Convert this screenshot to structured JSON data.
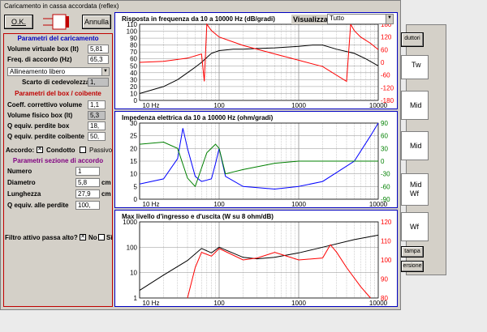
{
  "window": {
    "title": "Caricamento in cassa accordata (reflex)"
  },
  "toolbar": {
    "ok": "O.K.",
    "annulla": "Annulla"
  },
  "visualizza": {
    "label": "Visualizza",
    "value": "Tutto"
  },
  "params": {
    "title": "Parametri del caricamento",
    "vol_label": "Volume virtuale box (lt)",
    "vol": "5,81",
    "freq_label": "Freq. di accordo (Hz)",
    "freq": "65,3",
    "allineamento": "Allineamento libero",
    "scarto_label": "Scarto di cedevolezza",
    "scarto": "1,"
  },
  "box": {
    "title": "Parametri del box / coibente",
    "coeff_label": "Coeff. correttivo volume",
    "coeff": "1,1",
    "volfis_label": "Volume fisico box (lt)",
    "volfis": "5,3",
    "qbox_label": "Q equiv. perdite box",
    "qbox": "18,",
    "qcoib_label": "Q equiv. perdite coibente",
    "qcoib": "50,"
  },
  "accordo": {
    "label": "Accordo:",
    "condotto": "Condotto",
    "passivo": "Passivo"
  },
  "sezione": {
    "title": "Parametri sezione di accordo",
    "numero_label": "Numero",
    "numero": "1",
    "diametro_label": "Diametro",
    "diametro": "5,8",
    "diametro_unit": "cm",
    "lunghezza_label": "Lunghezza",
    "lunghezza": "27,9",
    "lunghezza_unit": "cm",
    "qperd_label": "Q equiv. alle perdite",
    "qperd": "100,"
  },
  "filtro": {
    "label": "Filtro attivo passa alto?",
    "no": "No",
    "si": "Sì"
  },
  "right": {
    "tab": "duttori",
    "tw": "Tw",
    "mid1": "Mid",
    "mid2": "Mid",
    "midwf1": "Mid",
    "midwf2": "Wf",
    "wf": "Wf",
    "stampa": "tampa",
    "versione": "ersione"
  },
  "chart_data": [
    {
      "type": "line",
      "title": "Risposta in frequenza da 10 a 10000 Hz (dB/gradi)",
      "xscale": "log",
      "xlim": [
        10,
        10000
      ],
      "ylim": [
        0,
        110
      ],
      "y2lim": [
        -180,
        180
      ],
      "yticks": [
        "110",
        "100",
        "90",
        "80",
        "70",
        "60",
        "50",
        "40",
        "30",
        "20",
        "10",
        "0"
      ],
      "y2ticks": [
        "180",
        "120",
        "60",
        "0",
        "-60",
        "-120",
        "-180"
      ],
      "xticks": [
        "10 Hz",
        "100",
        "1000",
        "10000"
      ],
      "series": [
        {
          "color": "#000000",
          "axis": "left",
          "x": [
            10,
            20,
            30,
            40,
            50,
            60,
            70,
            80,
            100,
            150,
            200,
            300,
            500,
            1000,
            1500,
            2000,
            3000,
            5000,
            7000,
            10000
          ],
          "y": [
            10,
            20,
            30,
            40,
            48,
            55,
            62,
            68,
            72,
            74,
            74,
            75,
            76,
            78,
            80,
            80,
            74,
            68,
            60,
            50
          ]
        },
        {
          "color": "#ff0000",
          "axis": "right",
          "x": [
            10,
            20,
            40,
            60,
            65,
            70,
            80,
            100,
            200,
            500,
            1000,
            2000,
            4000,
            4500,
            5000,
            6000,
            8000,
            10000
          ],
          "y": [
            0,
            5,
            20,
            40,
            -90,
            180,
            150,
            120,
            80,
            40,
            10,
            -20,
            -90,
            180,
            150,
            120,
            90,
            60
          ]
        }
      ]
    },
    {
      "type": "line",
      "title": "Impedenza elettrica da 10 a 10000 Hz (ohm/gradi)",
      "xscale": "log",
      "xlim": [
        10,
        10000
      ],
      "ylim": [
        0,
        30
      ],
      "y2lim": [
        -90,
        90
      ],
      "yticks": [
        "30",
        "25",
        "20",
        "15",
        "10",
        "5",
        "0"
      ],
      "y2ticks": [
        "90",
        "60",
        "30",
        "0",
        "-30",
        "-60",
        "-90"
      ],
      "xticks": [
        "10 Hz",
        "100",
        "1000",
        "10000"
      ],
      "series": [
        {
          "color": "#0000ff",
          "axis": "left",
          "x": [
            10,
            20,
            30,
            35,
            40,
            50,
            60,
            80,
            90,
            100,
            120,
            200,
            500,
            1000,
            2000,
            5000,
            8000,
            10000
          ],
          "y": [
            6,
            8,
            16,
            28,
            20,
            9,
            7,
            8,
            14,
            20,
            9,
            5,
            4,
            5,
            7,
            15,
            25,
            30
          ]
        },
        {
          "color": "#008000",
          "axis": "right",
          "x": [
            10,
            20,
            30,
            40,
            50,
            70,
            90,
            100,
            120,
            200,
            500,
            1000,
            5000,
            10000
          ],
          "y": [
            40,
            45,
            30,
            -40,
            -60,
            20,
            40,
            30,
            -30,
            -20,
            -5,
            0,
            0,
            0
          ]
        }
      ]
    },
    {
      "type": "line",
      "title": "Max livello d'ingresso e d'uscita (W su 8 ohm/dB)",
      "xscale": "log",
      "xlim": [
        10,
        10000
      ],
      "ylim": [
        1,
        1000
      ],
      "yscale": "log",
      "y2lim": [
        80,
        120
      ],
      "yticks": [
        "1000",
        "100",
        "10",
        "1"
      ],
      "y2ticks": [
        "120",
        "110",
        "100",
        "90",
        "80"
      ],
      "xticks": [
        "10 Hz",
        "100",
        "1000",
        "10000"
      ],
      "series": [
        {
          "color": "#000000",
          "axis": "left",
          "x": [
            10,
            20,
            40,
            60,
            80,
            100,
            200,
            300,
            500,
            1000,
            2000,
            5000,
            10000
          ],
          "y": [
            2,
            8,
            30,
            90,
            60,
            100,
            40,
            35,
            40,
            60,
            100,
            200,
            300
          ]
        },
        {
          "color": "#ff0000",
          "axis": "right",
          "x": [
            40,
            50,
            60,
            80,
            100,
            200,
            300,
            500,
            1000,
            2000,
            2500,
            3000,
            4000,
            6000,
            8000
          ],
          "y": [
            80,
            96,
            104,
            102,
            106,
            100,
            101,
            104,
            100,
            101,
            108,
            104,
            96,
            86,
            80
          ]
        }
      ]
    }
  ]
}
